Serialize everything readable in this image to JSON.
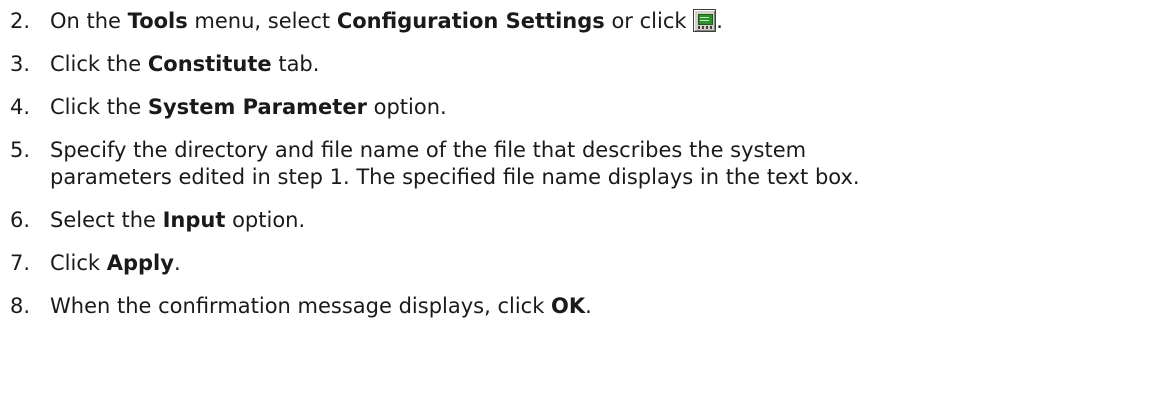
{
  "steps": [
    {
      "number": "2.",
      "parts": [
        "On the ",
        "Tools",
        " menu, select ",
        "Configuration Settings",
        " or click ",
        "."
      ],
      "icon": "configuration-settings-icon"
    },
    {
      "number": "3.",
      "parts": [
        "Click the ",
        "Constitute",
        " tab."
      ]
    },
    {
      "number": "4.",
      "parts": [
        "Click the ",
        "System Parameter",
        " option."
      ]
    },
    {
      "number": "5.",
      "line1": "Specify the directory and file name of the file that describes the system",
      "line2": "parameters edited in step 1. The specified file name displays in the text box."
    },
    {
      "number": "6.",
      "parts": [
        "Select the ",
        "Input",
        " option."
      ]
    },
    {
      "number": "7.",
      "parts": [
        "Click ",
        "Apply",
        "."
      ]
    },
    {
      "number": "8.",
      "parts": [
        "When the confirmation message displays, click ",
        "OK",
        "."
      ]
    }
  ]
}
